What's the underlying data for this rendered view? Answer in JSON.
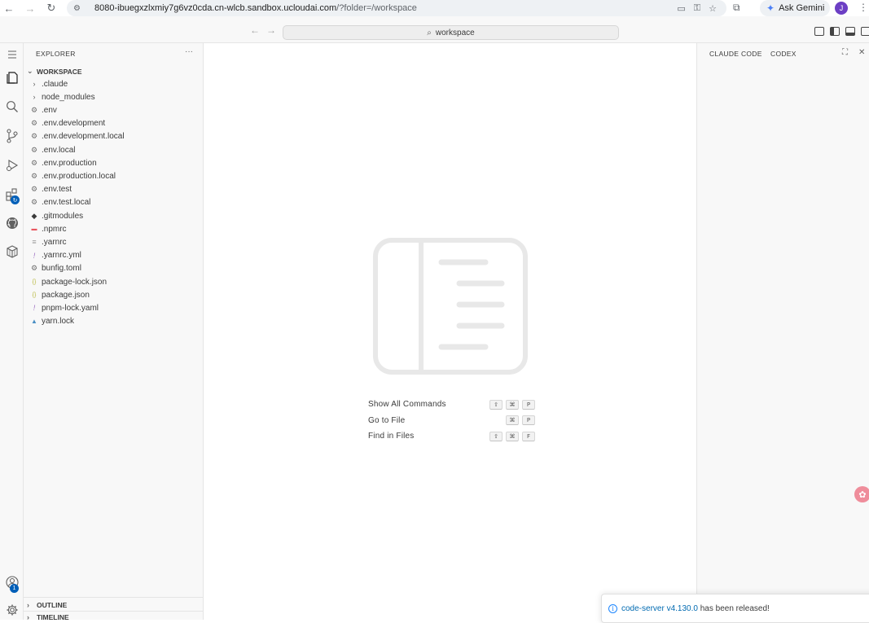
{
  "browser": {
    "url_host": "8080-ibuegxzlxmiy7g6vz0cda.cn-wlcb.sandbox.ucloudai.com",
    "url_path": "/?folder=/workspace",
    "gemini_label": "Ask Gemini",
    "avatar_letter": "J"
  },
  "titlebar": {
    "search_label": "workspace"
  },
  "sidebar": {
    "header": "EXPLORER",
    "more": "···",
    "workspace_label": "WORKSPACE",
    "items": [
      {
        "name": ".claude",
        "icon": "chevron-right",
        "color": "#616161"
      },
      {
        "name": "node_modules",
        "icon": "chevron-right",
        "color": "#616161"
      },
      {
        "name": ".env",
        "icon": "gear",
        "color": "#6d6d6d"
      },
      {
        "name": ".env.development",
        "icon": "gear",
        "color": "#6d6d6d"
      },
      {
        "name": ".env.development.local",
        "icon": "gear",
        "color": "#6d6d6d"
      },
      {
        "name": ".env.local",
        "icon": "gear",
        "color": "#6d6d6d"
      },
      {
        "name": ".env.production",
        "icon": "gear",
        "color": "#6d6d6d"
      },
      {
        "name": ".env.production.local",
        "icon": "gear",
        "color": "#6d6d6d"
      },
      {
        "name": ".env.test",
        "icon": "gear",
        "color": "#6d6d6d"
      },
      {
        "name": ".env.test.local",
        "icon": "gear",
        "color": "#6d6d6d"
      },
      {
        "name": ".gitmodules",
        "icon": "git-diamond",
        "color": "#3b3b3b"
      },
      {
        "name": ".npmrc",
        "icon": "npm",
        "color": "#e8565f"
      },
      {
        "name": ".yarnrc",
        "icon": "lines",
        "color": "#9a9a9a"
      },
      {
        "name": ".yarnrc.yml",
        "icon": "exclamation",
        "color": "#a074c4"
      },
      {
        "name": "bunfig.toml",
        "icon": "gear",
        "color": "#6d6d6d"
      },
      {
        "name": "package-lock.json",
        "icon": "braces",
        "color": "#b7b73b"
      },
      {
        "name": "package.json",
        "icon": "braces",
        "color": "#b7b73b"
      },
      {
        "name": "pnpm-lock.yaml",
        "icon": "exclamation",
        "color": "#a074c4"
      },
      {
        "name": "yarn.lock",
        "icon": "yarn",
        "color": "#4a8fc4"
      }
    ],
    "outline_label": "OUTLINE",
    "timeline_label": "TIMELINE"
  },
  "editor": {
    "shortcuts": [
      {
        "label": "Show All Commands",
        "keys": [
          "⇧",
          "⌘",
          "P"
        ]
      },
      {
        "label": "Go to File",
        "keys": [
          "⌘",
          "P"
        ]
      },
      {
        "label": "Find in Files",
        "keys": [
          "⇧",
          "⌘",
          "F"
        ]
      }
    ]
  },
  "aux": {
    "tab1": "CLAUDE CODE",
    "tab2": "CODEX"
  },
  "activity": {
    "extensions_badge": "",
    "accounts_badge": "1"
  },
  "notification": {
    "link_text": "code-server v4.130.0",
    "rest_text": " has been released!"
  }
}
